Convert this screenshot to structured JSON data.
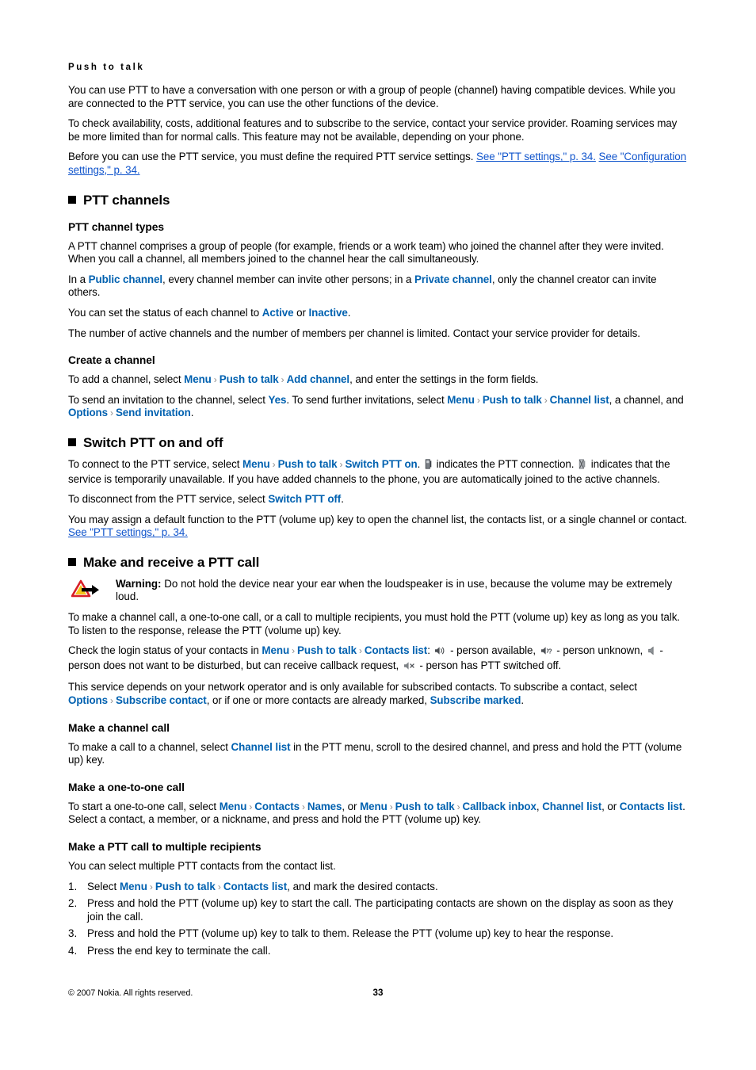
{
  "header": {
    "running_title": "Push to talk"
  },
  "colors": {
    "ui_term": "#0061b0",
    "link": "#1155cc",
    "chevron": "#8a8a8a",
    "warning_triangle_outline": "#d81f26",
    "warning_triangle_fill": "#f5c518",
    "text": "#000000"
  },
  "intro": {
    "p1": "You can use PTT to have a conversation with one person or with a group of people (channel) having compatible devices. While you are connected to the PTT service, you can use the other functions of the device.",
    "p2": "To check availability, costs, additional features and to subscribe to the service, contact your service provider. Roaming services may be more limited than for normal calls. This feature may not be available, depending on your phone.",
    "p3_pre": "Before you can use the PTT service, you must define the required PTT service settings. ",
    "p3_link1": "See \"PTT settings,\" p. 34.",
    "p3_link2": "See \"Configuration settings,\" p. 34."
  },
  "section_ptt_channels": {
    "heading": "PTT channels",
    "sub_channel_types": {
      "heading": "PTT channel types",
      "p1": "A PTT channel comprises a group of people (for example, friends or a work team) who joined the channel after they were invited. When you call a channel, all members joined to the channel hear the call simultaneously.",
      "p2_a": "In a ",
      "p2_public": "Public channel",
      "p2_b": ", every channel member can invite other persons; in a ",
      "p2_private": "Private channel",
      "p2_c": ", only the channel creator can invite others.",
      "p3_a": "You can set the status of each channel to ",
      "p3_active": "Active",
      "p3_b": " or ",
      "p3_inactive": "Inactive",
      "p3_c": ".",
      "p4": "The number of active channels and the number of members per channel is limited. Contact your service provider for details."
    },
    "sub_create_channel": {
      "heading": "Create a channel",
      "p1_a": "To add a channel, select ",
      "p1_menu": "Menu",
      "p1_ptt": "Push to talk",
      "p1_add": "Add channel",
      "p1_b": ", and enter the settings in the form fields.",
      "p2_a": "To send an invitation to the channel, select ",
      "p2_yes": "Yes",
      "p2_b": ". To send further invitations, select ",
      "p2_menu": "Menu",
      "p2_ptt": "Push to talk",
      "p2_chanlist": "Channel list",
      "p2_c": ", a channel, and ",
      "p2_options": "Options",
      "p2_sendinv": "Send invitation",
      "p2_d": "."
    }
  },
  "section_switch": {
    "heading": "Switch PTT on and off",
    "p1_a": "To connect to the PTT service, select ",
    "p1_menu": "Menu",
    "p1_ptt": "Push to talk",
    "p1_switchon": "Switch PTT on",
    "p1_b": ". ",
    "p1_icon1": "ptt-connected-icon",
    "p1_c": " indicates the PTT connection. ",
    "p1_icon2": "ptt-unavailable-icon",
    "p1_d": " indicates that the service is temporarily unavailable. If you have added channels to the phone, you are automatically joined to the active channels.",
    "p2_a": "To disconnect from the PTT service, select ",
    "p2_switchoff": "Switch PTT off",
    "p2_b": ".",
    "p3_a": "You may assign a default function to the PTT (volume up) key to open the channel list, the contacts list, or a single channel or contact. ",
    "p3_link": "See \"PTT settings,\" p. 34."
  },
  "section_make_receive": {
    "heading": "Make and receive a PTT call",
    "warning": {
      "icon": "warning-triangle-arrow-icon",
      "label": "Warning:",
      "text": " Do not hold the device near your ear when the loudspeaker is in use, because the volume may be extremely loud."
    },
    "p1": "To make a channel call, a one-to-one call, or a call to multiple recipients, you must hold the PTT (volume up) key as long as you talk. To listen to the response, release the PTT (volume up) key.",
    "p2_a": "Check the login status of your contacts in ",
    "p2_menu": "Menu",
    "p2_ptt": "Push to talk",
    "p2_contacts": "Contacts list",
    "p2_b": ": ",
    "p2_icon1": "speaker-available-icon",
    "p2_c": " - person available, ",
    "p2_icon2": "speaker-unknown-icon",
    "p2_d": " - person unknown, ",
    "p2_icon3": "speaker-dnd-icon",
    "p2_e": " - person does not want to be disturbed, but can receive callback request, ",
    "p2_icon4": "speaker-off-icon",
    "p2_f": " - person has PTT switched off.",
    "p3_a": "This service depends on your network operator and is only available for subscribed contacts. To subscribe a contact, select ",
    "p3_options": "Options",
    "p3_subscribe": "Subscribe contact",
    "p3_b": ", or if one or more contacts are already marked, ",
    "p3_submarked": "Subscribe marked",
    "p3_c": ".",
    "sub_channel_call": {
      "heading": "Make a channel call",
      "p1_a": "To make a call to a channel, select ",
      "p1_chanlist": "Channel list",
      "p1_b": " in the PTT menu, scroll to the desired channel, and press and hold the PTT (volume up) key."
    },
    "sub_one_to_one": {
      "heading": "Make a one-to-one call",
      "p1_a": "To start a one-to-one call, select ",
      "p1_menu": "Menu",
      "p1_contacts": "Contacts",
      "p1_names": "Names",
      "p1_b": ", or ",
      "p1_menu2": "Menu",
      "p1_ptt": "Push to talk",
      "p1_callback": "Callback inbox",
      "p1_comma": ", ",
      "p1_chanlist": "Channel list",
      "p1_c": ", or ",
      "p1_contactslist": "Contacts list",
      "p1_d": ". Select a contact, a member, or a nickname, and press and hold the PTT (volume up) key."
    },
    "sub_multiple": {
      "heading": "Make a PTT call to multiple recipients",
      "p1": "You can select multiple PTT contacts from the contact list.",
      "steps": [
        {
          "pre": "Select ",
          "ui1": "Menu",
          "ui2": "Push to talk",
          "ui3": "Contacts list",
          "post": ", and mark the desired contacts."
        },
        {
          "pre": "Press and hold the PTT (volume up) key to start the call. The participating contacts are shown on the display as soon as they join the call.",
          "ui1": "",
          "ui2": "",
          "ui3": "",
          "post": ""
        },
        {
          "pre": "Press and hold the PTT (volume up) key to talk to them. Release the PTT (volume up) key to hear the response.",
          "ui1": "",
          "ui2": "",
          "ui3": "",
          "post": ""
        },
        {
          "pre": "Press the end key to terminate the call.",
          "ui1": "",
          "ui2": "",
          "ui3": "",
          "post": ""
        }
      ]
    }
  },
  "footer": {
    "copyright": "© 2007 Nokia. All rights reserved.",
    "page_number": "33"
  }
}
